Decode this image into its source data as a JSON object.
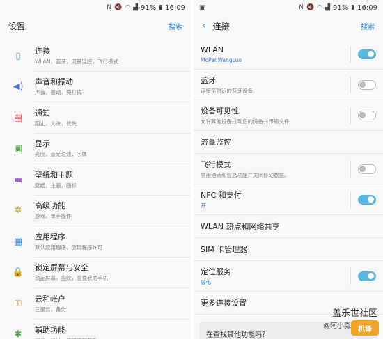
{
  "left": {
    "status": {
      "battery": "91%",
      "time": "16:09"
    },
    "appbar": {
      "title": "设置",
      "search": "搜索"
    },
    "items": [
      {
        "title": "连接",
        "subtitle": "WLAN，蓝牙，流量监控，飞行模式",
        "icon": "connections-icon",
        "color": "#3a8fd6"
      },
      {
        "title": "声音和振动",
        "subtitle": "声音，振动，免打扰",
        "icon": "sound-icon",
        "color": "#4c6ed6"
      },
      {
        "title": "通知",
        "subtitle": "阻止，允许，优先",
        "icon": "notification-icon",
        "color": "#e45b4f"
      },
      {
        "title": "显示",
        "subtitle": "亮度，蓝光过滤，字体",
        "icon": "display-icon",
        "color": "#5aa74a"
      },
      {
        "title": "壁纸和主题",
        "subtitle": "壁纸，主题，图标",
        "icon": "wallpaper-icon",
        "color": "#9c5bd1"
      },
      {
        "title": "高级功能",
        "subtitle": "游戏，单手操作",
        "icon": "advanced-icon",
        "color": "#e8a723"
      },
      {
        "title": "应用程序",
        "subtitle": "默认应用程序，应用程序许可",
        "icon": "apps-icon",
        "color": "#3b8fd6"
      },
      {
        "title": "锁定屏幕与安全",
        "subtitle": "锁定屏幕，指纹，查找我的手机",
        "icon": "lock-icon",
        "color": "#6b63c9"
      },
      {
        "title": "云和帐户",
        "subtitle": "三星云，备份",
        "icon": "key-icon",
        "color": "#f08a24"
      },
      {
        "title": "辅助功能",
        "subtitle": "视觉，听觉，灵巧度和互动",
        "icon": "accessibility-icon",
        "color": "#4caf50"
      }
    ]
  },
  "right": {
    "status": {
      "battery": "91%",
      "time": "16:09"
    },
    "appbar": {
      "title": "连接",
      "search": "搜索"
    },
    "rows": [
      {
        "title": "WLAN",
        "subtitle": "MoPanWangLuo",
        "blue": true,
        "toggle": "on"
      },
      {
        "title": "蓝牙",
        "subtitle": "连接至附近的蓝牙设备",
        "blue": false,
        "toggle": "off"
      },
      {
        "title": "设备可见性",
        "subtitle": "允许其他设备找到您的设备并传输文件",
        "blue": false,
        "toggle": "off"
      },
      {
        "title": "流量监控",
        "subtitle": "",
        "blue": false,
        "toggle": "none"
      },
      {
        "title": "飞行模式",
        "subtitle": "禁用通话和信息功能并关闭移动数据。",
        "blue": false,
        "toggle": "off"
      },
      {
        "title": "NFC 和支付",
        "subtitle": "开",
        "blue": true,
        "toggle": "on"
      },
      {
        "title": "WLAN 热点和网络共享",
        "subtitle": "",
        "blue": false,
        "toggle": "none"
      },
      {
        "title": "SIM 卡管理器",
        "subtitle": "",
        "blue": false,
        "toggle": "none"
      },
      {
        "title": "定位服务",
        "subtitle": "省电",
        "blue": true,
        "toggle": "on"
      },
      {
        "title": "更多连接设置",
        "subtitle": "",
        "blue": false,
        "toggle": "none"
      }
    ],
    "find_box": "在查找其他功能吗？"
  },
  "watermark": {
    "site": "盖乐世社区",
    "author": "@阿小淼",
    "logo": "机锋"
  }
}
